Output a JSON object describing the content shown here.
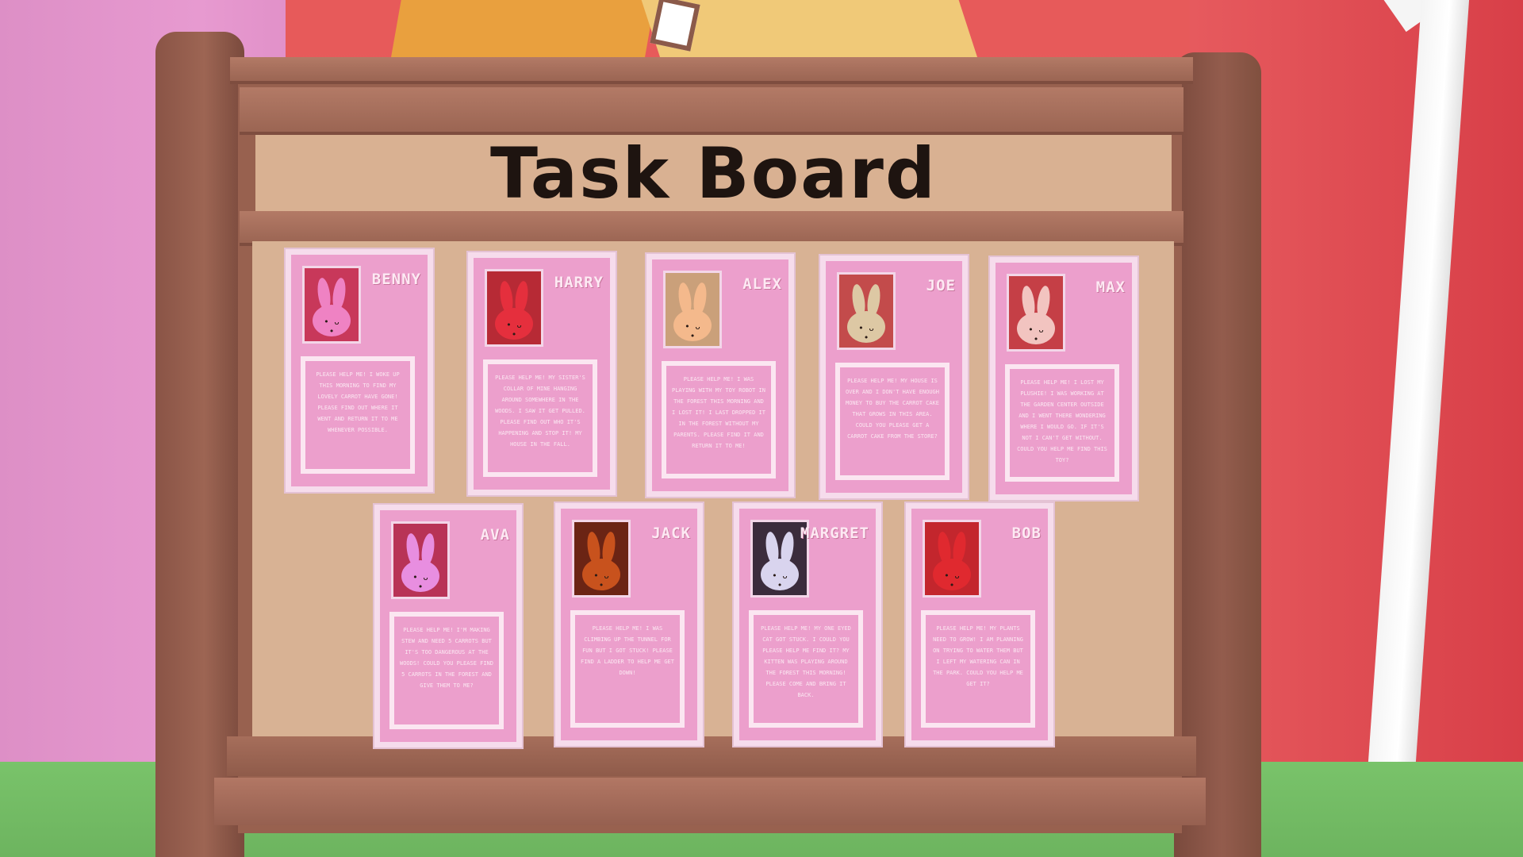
{
  "board": {
    "title": "Task Board"
  },
  "colors": {
    "card_pink": "#ec9fcc",
    "card_border": "#f6dcec",
    "board_wood": "#98614f",
    "cork": "#d8b294"
  },
  "cards": [
    {
      "name": "BENNY",
      "bunny_color": "#ef82c3",
      "portrait_bg": "#c8385a",
      "note": "Please help me! I woke up this morning to find my lovely carrot have gone! Please find out where it went and return it to me whenever possible."
    },
    {
      "name": "HARRY",
      "bunny_color": "#e52f3d",
      "portrait_bg": "#b72a35",
      "note": "Please help me! My sister's collar of mine hanging around somewhere in the woods. I saw it get pulled. Please find out who it's happening and stop it! My house in the fall."
    },
    {
      "name": "ALEX",
      "bunny_color": "#f4b98c",
      "portrait_bg": "#caa07a",
      "note": "Please help me! I was playing with my toy robot in the forest this morning and I lost it! I last dropped it in the forest without my parents. Please find it and return it to me!"
    },
    {
      "name": "JOE",
      "bunny_color": "#ddc8a4",
      "portrait_bg": "#c34b4b",
      "note": "Please help me! My house is over and I don't have enough money to buy the carrot cake that grows in this area. Could you please get a carrot cake from the store?"
    },
    {
      "name": "MAX",
      "bunny_color": "#f2c4c0",
      "portrait_bg": "#c53f46",
      "note": "Please help me! I lost my plushie! I was working at the garden center outside and I went there wondering where I would go. If it's not I can't get without. Could you help me find this toy?"
    },
    {
      "name": "AVA",
      "bunny_color": "#e88ee0",
      "portrait_bg": "#b83356",
      "note": "Please help me! I'm making stew and need 5 carrots but it's too dangerous at the woods! Could you please find 5 carrots in the forest and give them to me?"
    },
    {
      "name": "JACK",
      "bunny_color": "#c8521d",
      "portrait_bg": "#6b2414",
      "note": "Please help me! I was climbing up the tunnel for fun but I got stuck! Please find a ladder to help me get down!"
    },
    {
      "name": "MARGRET",
      "bunny_color": "#d9d4ee",
      "portrait_bg": "#3b2c3c",
      "note": "Please help me! My one eyed cat got stuck. I could you please help me find it? My kitten was playing around the forest this morning! Please come and bring it back."
    },
    {
      "name": "BOB",
      "bunny_color": "#e0292f",
      "portrait_bg": "#c3262d",
      "note": "Please help me! My plants need to grow! I am planning on trying to water them but I left my watering can in the park. Could you help me get it?"
    }
  ]
}
